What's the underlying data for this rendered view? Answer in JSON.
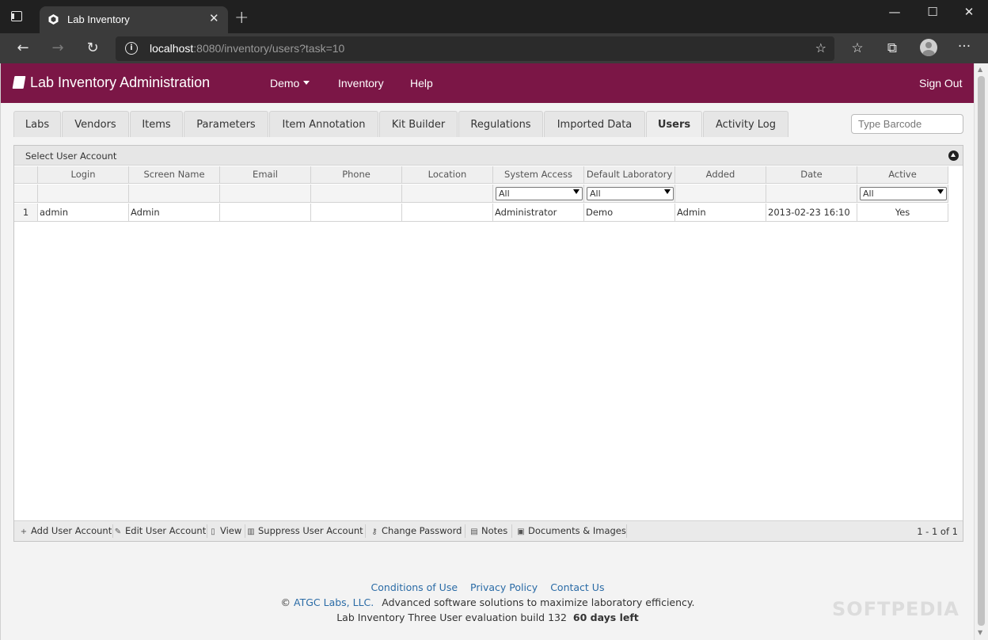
{
  "browser": {
    "tab_title": "Lab Inventory",
    "url_host": "localhost",
    "url_rest": ":8080/inventory/users?task=10",
    "close_glyph": "✕",
    "newtab_glyph": "+",
    "window_controls": [
      "—",
      "☐",
      "✕"
    ],
    "nav": [
      "←",
      "→",
      "↻"
    ],
    "tools": [
      "☆",
      "⧉"
    ],
    "more_glyph": "···",
    "info_glyph": "i",
    "fav_star_glyph": "☆"
  },
  "app": {
    "brand": "Lab Inventory Administration",
    "menu": {
      "demo": "Demo",
      "inventory": "Inventory",
      "help": "Help",
      "signout": "Sign Out"
    },
    "accent": "#7b1646"
  },
  "tabs": [
    {
      "label": "Labs"
    },
    {
      "label": "Vendors"
    },
    {
      "label": "Items"
    },
    {
      "label": "Parameters"
    },
    {
      "label": "Item Annotation"
    },
    {
      "label": "Kit Builder"
    },
    {
      "label": "Regulations"
    },
    {
      "label": "Imported Data"
    },
    {
      "label": "Users"
    },
    {
      "label": "Activity Log"
    }
  ],
  "barcode_placeholder": "Type Barcode",
  "grid": {
    "caption": "Select User Account",
    "columns": [
      "Login",
      "Screen Name",
      "Email",
      "Phone",
      "Location",
      "System Access",
      "Default Laboratory",
      "Added",
      "Date",
      "Active"
    ],
    "filters": {
      "system_access": "All",
      "default_laboratory": "All",
      "active": "All"
    },
    "rows": [
      {
        "num": "1",
        "login": "admin",
        "screen_name": "Admin",
        "email": "",
        "phone": "",
        "location": "",
        "system_access": "Administrator",
        "default_laboratory": "Demo",
        "added": "Admin",
        "date": "2013-02-23 16:10",
        "active": "Yes"
      }
    ],
    "footer": {
      "add": "Add User Account",
      "edit": "Edit User Account",
      "view": "View",
      "suppress": "Suppress User Account",
      "password": "Change Password",
      "notes": "Notes",
      "docs": "Documents & Images",
      "pager": "1 - 1 of 1"
    }
  },
  "footer": {
    "conditions": "Conditions of Use",
    "privacy": "Privacy Policy",
    "contact": "Contact Us",
    "copyright_symbol": "©",
    "company": "ATGC Labs, LLC.",
    "tagline": "Advanced software solutions to maximize laboratory efficiency.",
    "evaluation": "Lab Inventory Three User evaluation build 132",
    "days_left": "60 days left"
  },
  "watermark": "SOFTPEDIA"
}
